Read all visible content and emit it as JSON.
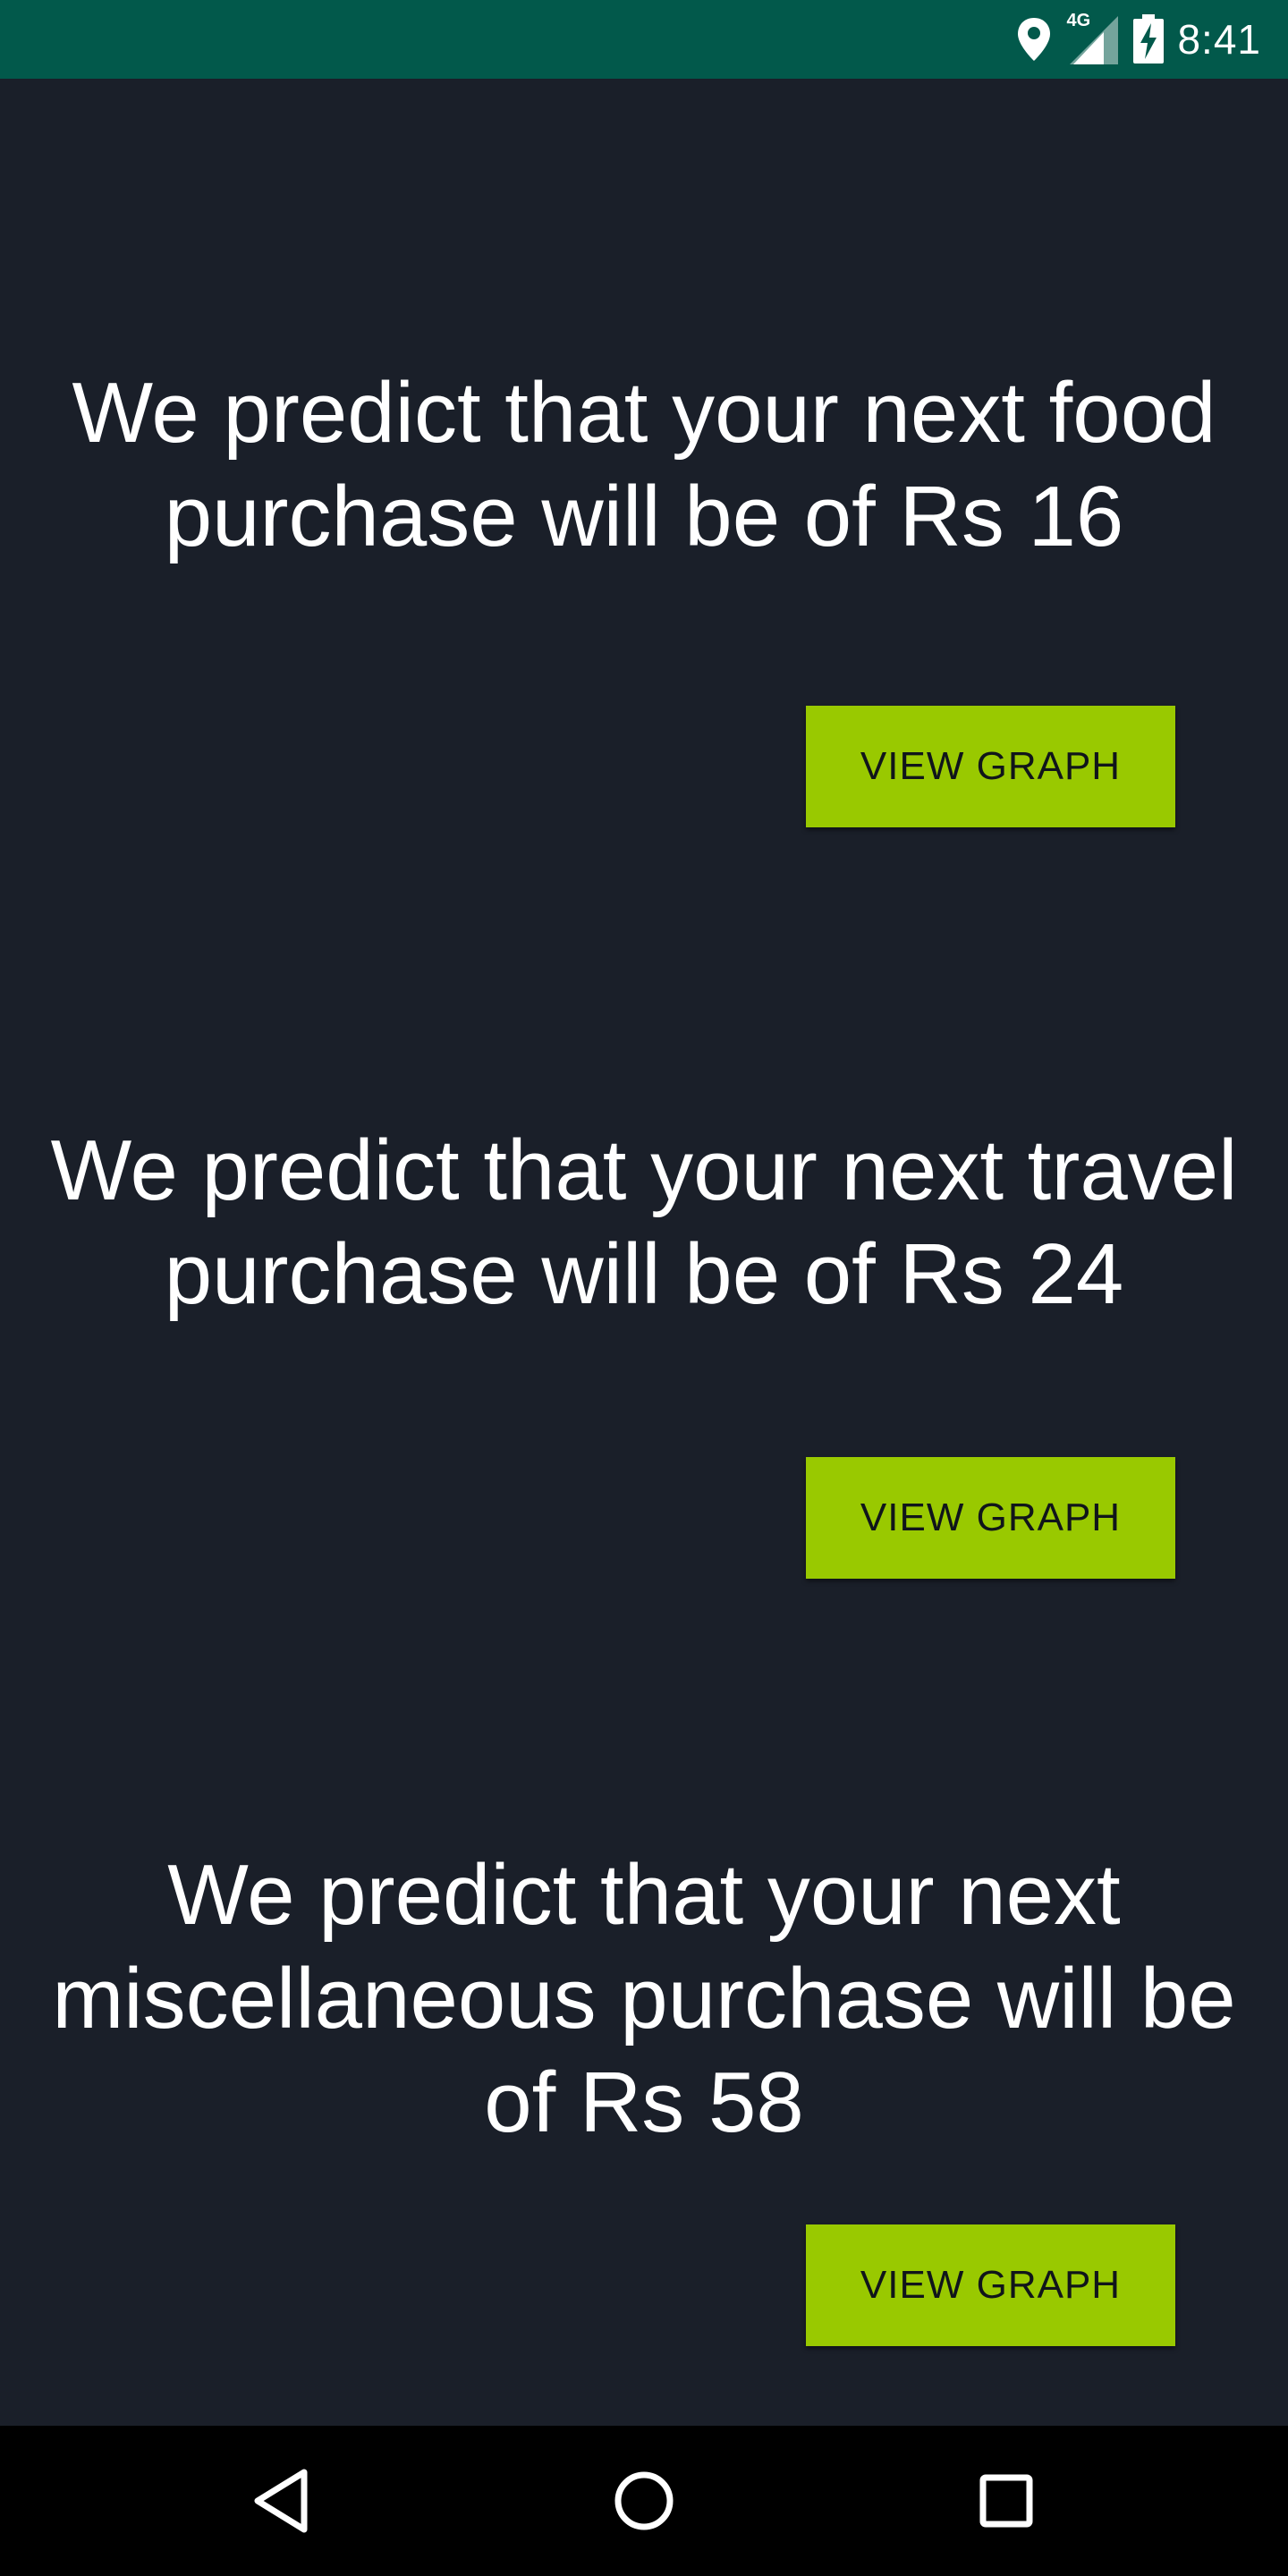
{
  "status_bar": {
    "time": "8:41",
    "network_label": "4G",
    "icons": [
      "location-icon",
      "signal-icon",
      "battery-charging-icon"
    ]
  },
  "predictions": [
    {
      "category": "food",
      "text": "We predict that your next food purchase will be of Rs 16",
      "button_label": "VIEW GRAPH"
    },
    {
      "category": "travel",
      "text": "We predict that your next travel purchase will be of Rs 24",
      "button_label": "VIEW GRAPH"
    },
    {
      "category": "miscellaneous",
      "text": "We predict that your next miscellaneous purchase will be of Rs 58",
      "button_label": "VIEW GRAPH"
    }
  ],
  "nav_bar": {
    "icons": [
      "back-icon",
      "home-icon",
      "recents-icon"
    ]
  },
  "colors": {
    "status_bar": "#02594b",
    "background": "#1a1f29",
    "button": "#99c900",
    "text": "#ffffff",
    "nav_bar": "#000000"
  }
}
